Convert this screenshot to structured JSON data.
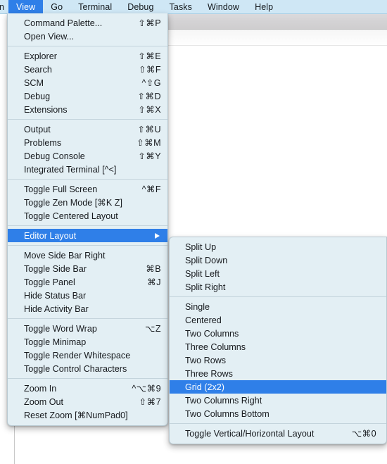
{
  "menubar": {
    "truncated_left_item": "n",
    "items": [
      {
        "label": "View",
        "active": true
      },
      {
        "label": "Go",
        "active": false
      },
      {
        "label": "Terminal",
        "active": false
      },
      {
        "label": "Debug",
        "active": false
      },
      {
        "label": "Tasks",
        "active": false
      },
      {
        "label": "Window",
        "active": false
      },
      {
        "label": "Help",
        "active": false
      }
    ]
  },
  "colors": {
    "menubar_background": "#cfe7f5",
    "menu_background": "#e3eff4",
    "highlight": "#2f7fe8",
    "highlight_text": "#ffffff",
    "text": "#16191d",
    "separator": "#c4d4dc"
  },
  "view_menu": {
    "groups": [
      {
        "items": [
          {
            "label": "Command Palette...",
            "accel": "⇧⌘P"
          },
          {
            "label": "Open View...",
            "accel": ""
          }
        ]
      },
      {
        "items": [
          {
            "label": "Explorer",
            "accel": "⇧⌘E"
          },
          {
            "label": "Search",
            "accel": "⇧⌘F"
          },
          {
            "label": "SCM",
            "accel": "^⇧G"
          },
          {
            "label": "Debug",
            "accel": "⇧⌘D"
          },
          {
            "label": "Extensions",
            "accel": "⇧⌘X"
          }
        ]
      },
      {
        "items": [
          {
            "label": "Output",
            "accel": "⇧⌘U"
          },
          {
            "label": "Problems",
            "accel": "⇧⌘M"
          },
          {
            "label": "Debug Console",
            "accel": "⇧⌘Y"
          },
          {
            "label": "Integrated Terminal [^<]",
            "accel": ""
          }
        ]
      },
      {
        "items": [
          {
            "label": "Toggle Full Screen",
            "accel": "^⌘F"
          },
          {
            "label": "Toggle Zen Mode [⌘K Z]",
            "accel": ""
          },
          {
            "label": "Toggle Centered Layout",
            "accel": ""
          }
        ]
      },
      {
        "items": [
          {
            "label": "Editor Layout",
            "accel": "",
            "highlight": true,
            "submenu": true
          }
        ]
      },
      {
        "items": [
          {
            "label": "Move Side Bar Right",
            "accel": ""
          },
          {
            "label": "Toggle Side Bar",
            "accel": "⌘B"
          },
          {
            "label": "Toggle Panel",
            "accel": "⌘J"
          },
          {
            "label": "Hide Status Bar",
            "accel": ""
          },
          {
            "label": "Hide Activity Bar",
            "accel": ""
          }
        ]
      },
      {
        "items": [
          {
            "label": "Toggle Word Wrap",
            "accel": "⌥Z"
          },
          {
            "label": "Toggle Minimap",
            "accel": ""
          },
          {
            "label": "Toggle Render Whitespace",
            "accel": ""
          },
          {
            "label": "Toggle Control Characters",
            "accel": ""
          }
        ]
      },
      {
        "items": [
          {
            "label": "Zoom In",
            "accel": "^⌥⌘9"
          },
          {
            "label": "Zoom Out",
            "accel": "⇧⌘7"
          },
          {
            "label": "Reset Zoom [⌘NumPad0]",
            "accel": ""
          }
        ]
      }
    ]
  },
  "editor_layout_submenu": {
    "groups": [
      {
        "items": [
          {
            "label": "Split Up",
            "accel": ""
          },
          {
            "label": "Split Down",
            "accel": ""
          },
          {
            "label": "Split Left",
            "accel": ""
          },
          {
            "label": "Split Right",
            "accel": ""
          }
        ]
      },
      {
        "items": [
          {
            "label": "Single",
            "accel": ""
          },
          {
            "label": "Centered",
            "accel": ""
          },
          {
            "label": "Two Columns",
            "accel": ""
          },
          {
            "label": "Three Columns",
            "accel": ""
          },
          {
            "label": "Two Rows",
            "accel": ""
          },
          {
            "label": "Three Rows",
            "accel": ""
          },
          {
            "label": "Grid (2x2)",
            "accel": "",
            "highlight": true
          },
          {
            "label": "Two Columns Right",
            "accel": ""
          },
          {
            "label": "Two Columns Bottom",
            "accel": ""
          }
        ]
      },
      {
        "items": [
          {
            "label": "Toggle Vertical/Horizontal Layout",
            "accel": "⌥⌘0"
          }
        ]
      }
    ]
  }
}
